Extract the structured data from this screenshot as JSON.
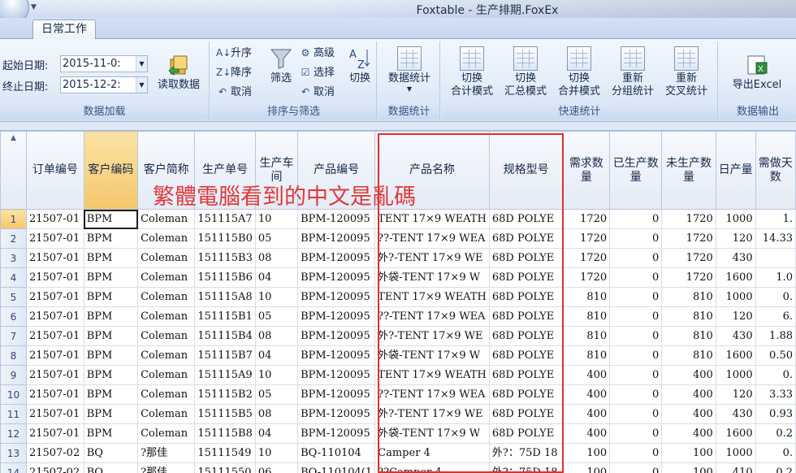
{
  "window": {
    "title": "Foxtable - 生产排期.FoxEx"
  },
  "tabs": [
    {
      "label": "日常工作"
    }
  ],
  "ribbon": {
    "load_group": {
      "start_label": "起始日期:",
      "start_value": "2015-11-0:",
      "end_label": "终止日期:",
      "end_value": "2015-12-2:",
      "read_btn": "读取数据",
      "group_label": "数据加载"
    },
    "sort_group": {
      "asc": "升序",
      "desc": "降序",
      "cancel_sort": "取消",
      "filter": "筛选",
      "advanced": "高级",
      "select": "选择",
      "cancel_filter": "取消",
      "toggle": "切换",
      "group_label": "排序与筛选"
    },
    "stats_group": {
      "btn": "数据统计",
      "group_label": "数据统计"
    },
    "quick_group": {
      "b1a": "切换",
      "b1b": "合计模式",
      "b2a": "切换",
      "b2b": "汇总模式",
      "b3a": "切换",
      "b3b": "合并模式",
      "b4a": "重新",
      "b4b": "分组统计",
      "b5a": "重新",
      "b5b": "交叉统计",
      "group_label": "快速统计"
    },
    "output_group": {
      "btn": "导出Excel",
      "group_label": "数据输出"
    }
  },
  "grid": {
    "columns": [
      "订单编号",
      "客户编码",
      "客户简称",
      "生产单号",
      "生产车间",
      "产品编号",
      "产品名称",
      "规格型号",
      "需求数量",
      "已生产数量",
      "未生产数量",
      "日产量",
      "需做天数"
    ],
    "rows": [
      [
        "1",
        "21507-01",
        "BPM",
        "Coleman",
        "151115A7",
        "10",
        "BPM-120095",
        "TENT 17×9 WEATH",
        "68D POLYE",
        "1720",
        "0",
        "1720",
        "1000",
        "1."
      ],
      [
        "2",
        "21507-01",
        "BPM",
        "Coleman",
        "151115B0",
        "05",
        "BPM-120095",
        "??-TENT 17×9 WEA",
        "68D POLYE",
        "1720",
        "0",
        "1720",
        "120",
        "14.33"
      ],
      [
        "3",
        "21507-01",
        "BPM",
        "Coleman",
        "151115B3",
        "08",
        "BPM-120095",
        "外?-TENT 17×9 WE",
        "68D POLYE",
        "1720",
        "0",
        "1720",
        "430",
        ""
      ],
      [
        "4",
        "21507-01",
        "BPM",
        "Coleman",
        "151115B6",
        "04",
        "BPM-120095",
        "外袋-TENT 17×9 W",
        "68D POLYE",
        "1720",
        "0",
        "1720",
        "1600",
        "1.0"
      ],
      [
        "5",
        "21507-01",
        "BPM",
        "Coleman",
        "151115A8",
        "10",
        "BPM-120095",
        "TENT 17×9 WEATH",
        "68D POLYE",
        "810",
        "0",
        "810",
        "1000",
        "0."
      ],
      [
        "6",
        "21507-01",
        "BPM",
        "Coleman",
        "151115B1",
        "05",
        "BPM-120095",
        "??-TENT 17×9 WEA",
        "68D POLYE",
        "810",
        "0",
        "810",
        "120",
        "6."
      ],
      [
        "7",
        "21507-01",
        "BPM",
        "Coleman",
        "151115B4",
        "08",
        "BPM-120095",
        "外?-TENT 17×9 WE",
        "68D POLYE",
        "810",
        "0",
        "810",
        "430",
        "1.88"
      ],
      [
        "8",
        "21507-01",
        "BPM",
        "Coleman",
        "151115B7",
        "04",
        "BPM-120095",
        "外袋-TENT 17×9 W",
        "68D POLYE",
        "810",
        "0",
        "810",
        "1600",
        "0.50"
      ],
      [
        "9",
        "21507-01",
        "BPM",
        "Coleman",
        "151115A9",
        "10",
        "BPM-120095",
        "TENT 17×9 WEATH",
        "68D POLYE",
        "400",
        "0",
        "400",
        "1000",
        "0."
      ],
      [
        "10",
        "21507-01",
        "BPM",
        "Coleman",
        "151115B2",
        "05",
        "BPM-120095",
        "??-TENT 17×9 WEA",
        "68D POLYE",
        "400",
        "0",
        "400",
        "120",
        "3.33"
      ],
      [
        "11",
        "21507-01",
        "BPM",
        "Coleman",
        "151115B5",
        "08",
        "BPM-120095",
        "外?-TENT 17×9 WE",
        "68D POLYE",
        "400",
        "0",
        "400",
        "430",
        "0.93"
      ],
      [
        "12",
        "21507-01",
        "BPM",
        "Coleman",
        "151115B8",
        "04",
        "BPM-120095",
        "外袋-TENT 17×9 W",
        "68D POLYE",
        "400",
        "0",
        "400",
        "1600",
        "0.2"
      ],
      [
        "13",
        "21507-02",
        "BQ",
        "?那佳",
        "15111549",
        "10",
        "BQ-110104",
        "Camper 4",
        "外?：75D 18",
        "100",
        "0",
        "100",
        "1000",
        "0."
      ],
      [
        "14",
        "21507-02",
        "BQ",
        "?那佳",
        "15111550",
        "06",
        "BQ-110104(1",
        "??Camper 4",
        "外?：75D 18",
        "100",
        "0",
        "100",
        "410",
        "0.2"
      ]
    ]
  },
  "annotation": {
    "text": "繁體電腦看到的中文是亂碼"
  }
}
